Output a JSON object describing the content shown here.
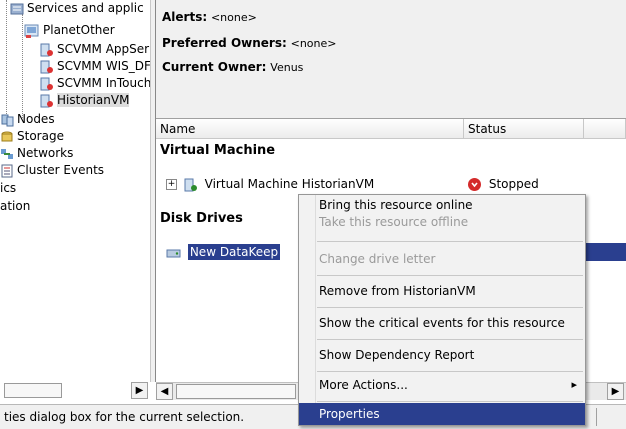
{
  "tree": {
    "items": [
      {
        "label": "Services and applic",
        "icon": "services-icon"
      },
      {
        "label": "PlanetOther",
        "icon": "vm-group-icon"
      },
      {
        "label": "SCVMM AppSer",
        "icon": "vm-icon"
      },
      {
        "label": "SCVMM WIS_DF",
        "icon": "vm-icon"
      },
      {
        "label": "SCVMM InTouch",
        "icon": "vm-icon"
      },
      {
        "label": "HistorianVM",
        "icon": "vm-icon"
      },
      {
        "label": "Nodes",
        "icon": "nodes-icon"
      },
      {
        "label": "Storage",
        "icon": "storage-icon"
      },
      {
        "label": "Networks",
        "icon": "networks-icon"
      },
      {
        "label": "Cluster Events",
        "icon": "events-icon"
      },
      {
        "label": "ics",
        "icon": ""
      },
      {
        "label": "ation",
        "icon": ""
      }
    ]
  },
  "detail": {
    "alerts_label": "Alerts:",
    "alerts_value": "<none>",
    "owners_label": "Preferred Owners:",
    "owners_value": "<none>",
    "current_label": "Current Owner:",
    "current_value": "Venus"
  },
  "list": {
    "columns": [
      "Name",
      "Status"
    ],
    "group_vm": "Virtual Machine",
    "vm_row": {
      "expander": "⊞",
      "name": "Virtual Machine HistorianVM",
      "status": "Stopped"
    },
    "group_disk": "Disk Drives",
    "disk_row": {
      "name": "New DataKeep"
    }
  },
  "context_menu": {
    "items": [
      {
        "label": "Bring this resource online",
        "enabled": true
      },
      {
        "label": "Take this resource offline",
        "enabled": false
      },
      {
        "label": "Change drive letter",
        "enabled": false
      },
      {
        "label": "Remove from HistorianVM",
        "enabled": true
      },
      {
        "label": "Show the critical events for this resource",
        "enabled": true
      },
      {
        "label": "Show Dependency Report",
        "enabled": true
      },
      {
        "label": "More Actions...",
        "enabled": true,
        "submenu_arrow": "▸"
      },
      {
        "label": "Properties",
        "enabled": true,
        "highlighted": true
      }
    ]
  },
  "status_bar": {
    "text": "ties dialog box for the current selection."
  },
  "colors": {
    "selection": "#2a3f8f",
    "panel": "#f0f0f0",
    "stopped": "#d42b2b"
  }
}
